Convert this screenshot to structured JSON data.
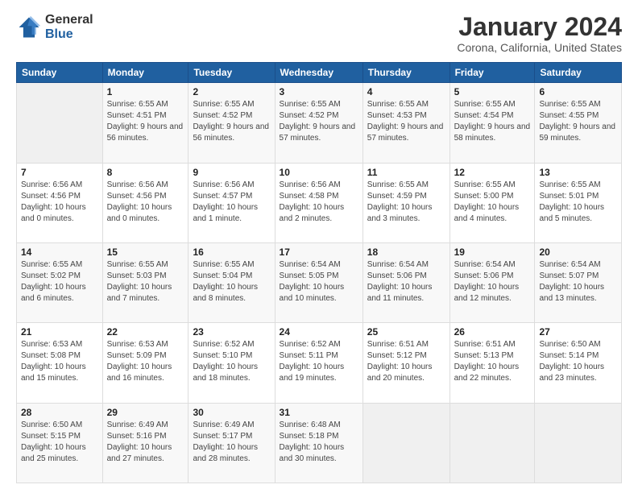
{
  "logo": {
    "general": "General",
    "blue": "Blue"
  },
  "header": {
    "month": "January 2024",
    "location": "Corona, California, United States"
  },
  "weekdays": [
    "Sunday",
    "Monday",
    "Tuesday",
    "Wednesday",
    "Thursday",
    "Friday",
    "Saturday"
  ],
  "weeks": [
    [
      {
        "day": "",
        "sunrise": "",
        "sunset": "",
        "daylight": ""
      },
      {
        "day": "1",
        "sunrise": "Sunrise: 6:55 AM",
        "sunset": "Sunset: 4:51 PM",
        "daylight": "Daylight: 9 hours and 56 minutes."
      },
      {
        "day": "2",
        "sunrise": "Sunrise: 6:55 AM",
        "sunset": "Sunset: 4:52 PM",
        "daylight": "Daylight: 9 hours and 56 minutes."
      },
      {
        "day": "3",
        "sunrise": "Sunrise: 6:55 AM",
        "sunset": "Sunset: 4:52 PM",
        "daylight": "Daylight: 9 hours and 57 minutes."
      },
      {
        "day": "4",
        "sunrise": "Sunrise: 6:55 AM",
        "sunset": "Sunset: 4:53 PM",
        "daylight": "Daylight: 9 hours and 57 minutes."
      },
      {
        "day": "5",
        "sunrise": "Sunrise: 6:55 AM",
        "sunset": "Sunset: 4:54 PM",
        "daylight": "Daylight: 9 hours and 58 minutes."
      },
      {
        "day": "6",
        "sunrise": "Sunrise: 6:55 AM",
        "sunset": "Sunset: 4:55 PM",
        "daylight": "Daylight: 9 hours and 59 minutes."
      }
    ],
    [
      {
        "day": "7",
        "sunrise": "Sunrise: 6:56 AM",
        "sunset": "Sunset: 4:56 PM",
        "daylight": "Daylight: 10 hours and 0 minutes."
      },
      {
        "day": "8",
        "sunrise": "Sunrise: 6:56 AM",
        "sunset": "Sunset: 4:56 PM",
        "daylight": "Daylight: 10 hours and 0 minutes."
      },
      {
        "day": "9",
        "sunrise": "Sunrise: 6:56 AM",
        "sunset": "Sunset: 4:57 PM",
        "daylight": "Daylight: 10 hours and 1 minute."
      },
      {
        "day": "10",
        "sunrise": "Sunrise: 6:56 AM",
        "sunset": "Sunset: 4:58 PM",
        "daylight": "Daylight: 10 hours and 2 minutes."
      },
      {
        "day": "11",
        "sunrise": "Sunrise: 6:55 AM",
        "sunset": "Sunset: 4:59 PM",
        "daylight": "Daylight: 10 hours and 3 minutes."
      },
      {
        "day": "12",
        "sunrise": "Sunrise: 6:55 AM",
        "sunset": "Sunset: 5:00 PM",
        "daylight": "Daylight: 10 hours and 4 minutes."
      },
      {
        "day": "13",
        "sunrise": "Sunrise: 6:55 AM",
        "sunset": "Sunset: 5:01 PM",
        "daylight": "Daylight: 10 hours and 5 minutes."
      }
    ],
    [
      {
        "day": "14",
        "sunrise": "Sunrise: 6:55 AM",
        "sunset": "Sunset: 5:02 PM",
        "daylight": "Daylight: 10 hours and 6 minutes."
      },
      {
        "day": "15",
        "sunrise": "Sunrise: 6:55 AM",
        "sunset": "Sunset: 5:03 PM",
        "daylight": "Daylight: 10 hours and 7 minutes."
      },
      {
        "day": "16",
        "sunrise": "Sunrise: 6:55 AM",
        "sunset": "Sunset: 5:04 PM",
        "daylight": "Daylight: 10 hours and 8 minutes."
      },
      {
        "day": "17",
        "sunrise": "Sunrise: 6:54 AM",
        "sunset": "Sunset: 5:05 PM",
        "daylight": "Daylight: 10 hours and 10 minutes."
      },
      {
        "day": "18",
        "sunrise": "Sunrise: 6:54 AM",
        "sunset": "Sunset: 5:06 PM",
        "daylight": "Daylight: 10 hours and 11 minutes."
      },
      {
        "day": "19",
        "sunrise": "Sunrise: 6:54 AM",
        "sunset": "Sunset: 5:06 PM",
        "daylight": "Daylight: 10 hours and 12 minutes."
      },
      {
        "day": "20",
        "sunrise": "Sunrise: 6:54 AM",
        "sunset": "Sunset: 5:07 PM",
        "daylight": "Daylight: 10 hours and 13 minutes."
      }
    ],
    [
      {
        "day": "21",
        "sunrise": "Sunrise: 6:53 AM",
        "sunset": "Sunset: 5:08 PM",
        "daylight": "Daylight: 10 hours and 15 minutes."
      },
      {
        "day": "22",
        "sunrise": "Sunrise: 6:53 AM",
        "sunset": "Sunset: 5:09 PM",
        "daylight": "Daylight: 10 hours and 16 minutes."
      },
      {
        "day": "23",
        "sunrise": "Sunrise: 6:52 AM",
        "sunset": "Sunset: 5:10 PM",
        "daylight": "Daylight: 10 hours and 18 minutes."
      },
      {
        "day": "24",
        "sunrise": "Sunrise: 6:52 AM",
        "sunset": "Sunset: 5:11 PM",
        "daylight": "Daylight: 10 hours and 19 minutes."
      },
      {
        "day": "25",
        "sunrise": "Sunrise: 6:51 AM",
        "sunset": "Sunset: 5:12 PM",
        "daylight": "Daylight: 10 hours and 20 minutes."
      },
      {
        "day": "26",
        "sunrise": "Sunrise: 6:51 AM",
        "sunset": "Sunset: 5:13 PM",
        "daylight": "Daylight: 10 hours and 22 minutes."
      },
      {
        "day": "27",
        "sunrise": "Sunrise: 6:50 AM",
        "sunset": "Sunset: 5:14 PM",
        "daylight": "Daylight: 10 hours and 23 minutes."
      }
    ],
    [
      {
        "day": "28",
        "sunrise": "Sunrise: 6:50 AM",
        "sunset": "Sunset: 5:15 PM",
        "daylight": "Daylight: 10 hours and 25 minutes."
      },
      {
        "day": "29",
        "sunrise": "Sunrise: 6:49 AM",
        "sunset": "Sunset: 5:16 PM",
        "daylight": "Daylight: 10 hours and 27 minutes."
      },
      {
        "day": "30",
        "sunrise": "Sunrise: 6:49 AM",
        "sunset": "Sunset: 5:17 PM",
        "daylight": "Daylight: 10 hours and 28 minutes."
      },
      {
        "day": "31",
        "sunrise": "Sunrise: 6:48 AM",
        "sunset": "Sunset: 5:18 PM",
        "daylight": "Daylight: 10 hours and 30 minutes."
      },
      {
        "day": "",
        "sunrise": "",
        "sunset": "",
        "daylight": ""
      },
      {
        "day": "",
        "sunrise": "",
        "sunset": "",
        "daylight": ""
      },
      {
        "day": "",
        "sunrise": "",
        "sunset": "",
        "daylight": ""
      }
    ]
  ]
}
